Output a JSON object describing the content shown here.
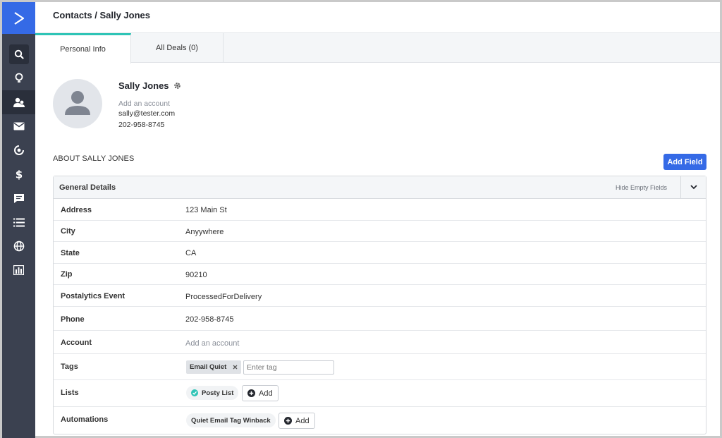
{
  "breadcrumb": "Contacts / Sally Jones",
  "tabs": [
    {
      "label": "Personal Info",
      "active": true
    },
    {
      "label": "All Deals (0)",
      "active": false
    }
  ],
  "contact": {
    "name": "Sally Jones",
    "add_account": "Add an account",
    "email": "sally@tester.com",
    "phone": "202-958-8745"
  },
  "about_heading": "ABOUT SALLY JONES",
  "add_field_label": "Add Field",
  "panel": {
    "title": "General Details",
    "hide_empty": "Hide Empty Fields"
  },
  "fields": {
    "address": {
      "label": "Address",
      "value": "123 Main St"
    },
    "city": {
      "label": "City",
      "value": "Anyywhere"
    },
    "state": {
      "label": "State",
      "value": "CA"
    },
    "zip": {
      "label": "Zip",
      "value": "90210"
    },
    "postalytics": {
      "label": "Postalytics Event",
      "value": "ProcessedForDelivery"
    },
    "phone": {
      "label": "Phone",
      "value": "202-958-8745"
    },
    "account": {
      "label": "Account",
      "value": "Add an account"
    },
    "tags": {
      "label": "Tags",
      "tag": "Email Quiet",
      "placeholder": "Enter tag"
    },
    "lists": {
      "label": "Lists",
      "item": "Posty List",
      "add_label": "Add"
    },
    "automations": {
      "label": "Automations",
      "item": "Quiet Email Tag Winback",
      "add_label": "Add"
    }
  },
  "colors": {
    "brand_blue": "#356ae6",
    "sidebar": "#3b4150",
    "tab_accent": "#2ec4b6",
    "list_check": "#2ec4b6"
  }
}
